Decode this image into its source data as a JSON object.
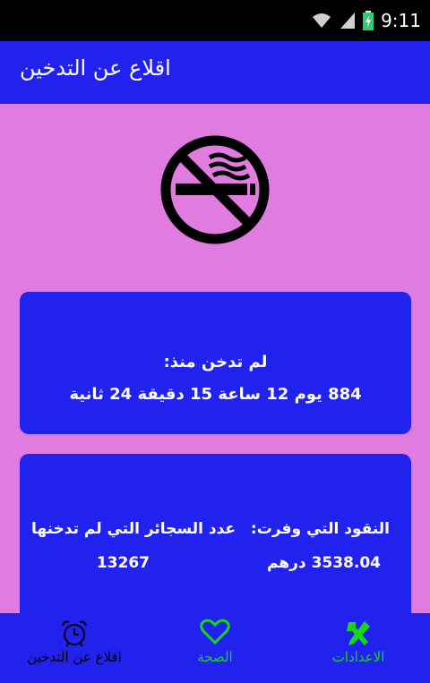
{
  "status_bar": {
    "time": "9:11"
  },
  "app_bar": {
    "title": "اقلاع عن التدخين"
  },
  "since_card": {
    "heading": "لم تدخن منذ:",
    "duration": "884 يوم 12 ساعة 15 دقيقة 24 ثانية"
  },
  "stats_card": {
    "money_label": "النقود التي وفرت:",
    "money_value": "3538.04 درهم",
    "cigarettes_label": "عدد السجائر التي لم تدخنها",
    "cigarettes_value": "13267"
  },
  "bottom_nav": {
    "settings": "الاعدادات",
    "health": "الصحة",
    "quit": "اقلاع عن التدخين"
  },
  "colors": {
    "background": "#e07be0",
    "primary": "#2222ee",
    "nav_active": "#16d616"
  },
  "icons": {
    "logo": "no-smoking-icon",
    "settings": "tools-icon",
    "health": "heart-icon",
    "quit": "alarm-clock-icon"
  }
}
